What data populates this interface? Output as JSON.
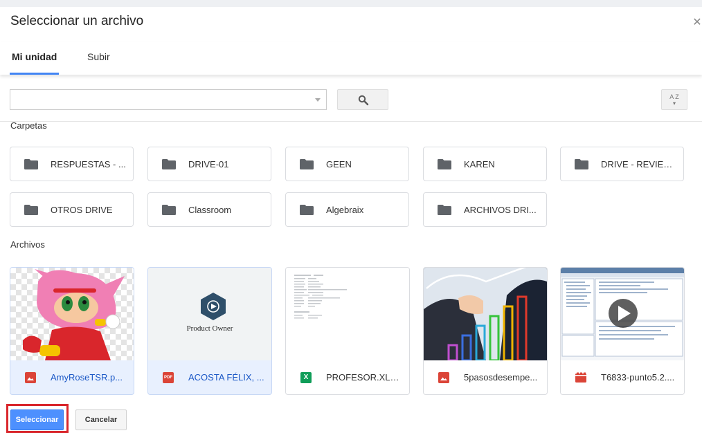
{
  "dialog": {
    "title": "Seleccionar un archivo"
  },
  "tabs": [
    {
      "label": "Mi unidad",
      "active": true
    },
    {
      "label": "Subir",
      "active": false
    }
  ],
  "search": {
    "value": "",
    "placeholder": ""
  },
  "sort": {
    "label": "A Z"
  },
  "sections": {
    "folders": "Carpetas",
    "files": "Archivos"
  },
  "folders": [
    {
      "name": "RESPUESTAS - ..."
    },
    {
      "name": "DRIVE-01"
    },
    {
      "name": "GEEN"
    },
    {
      "name": "KAREN"
    },
    {
      "name": "DRIVE - REVIEW..."
    },
    {
      "name": "OTROS DRIVE"
    },
    {
      "name": "Classroom"
    },
    {
      "name": "Algebraix"
    },
    {
      "name": "ARCHIVOS DRI..."
    }
  ],
  "files": [
    {
      "name": "AmyRoseTSR.p...",
      "type": "image",
      "icon": "image-icon",
      "selected": true
    },
    {
      "name": "ACOSTA FÉLIX, ...",
      "type": "pdf",
      "icon": "pdf-icon",
      "badge": "PDF",
      "thumb_text": "Product Owner",
      "selected": true
    },
    {
      "name": "PROFESOR.XLS...",
      "type": "spreadsheet",
      "icon": "excel-icon",
      "badge": "X",
      "selected": false
    },
    {
      "name": "5pasosdesempe...",
      "type": "image",
      "icon": "image-icon",
      "selected": false
    },
    {
      "name": "T6833-punto5.2....",
      "type": "video",
      "icon": "video-icon",
      "selected": false
    }
  ],
  "buttons": {
    "select": "Seleccionar",
    "cancel": "Cancelar"
  },
  "colors": {
    "accent": "#4285f4",
    "select_button": "#4d90fe",
    "highlight": "#d9262c",
    "folder_icon": "#5f6368",
    "image_icon": "#db4437",
    "excel_icon": "#0f9d58"
  }
}
